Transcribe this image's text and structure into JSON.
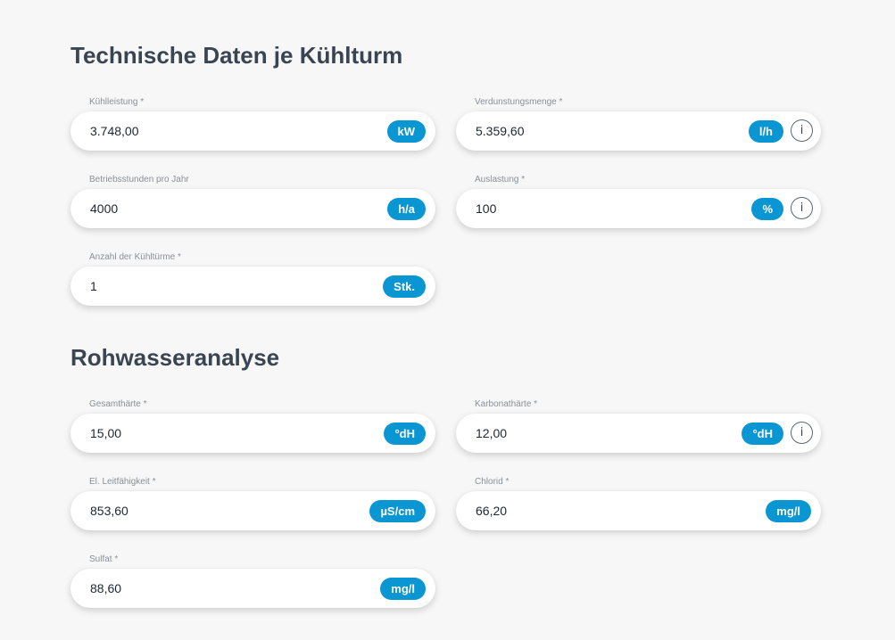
{
  "sections": {
    "technical": {
      "title": "Technische Daten je Kühlturm"
    },
    "water": {
      "title": "Rohwasseranalyse"
    }
  },
  "fields": {
    "kuehlleistung": {
      "label": "Kühlleistung *",
      "value": "3.748,00",
      "unit": "kW"
    },
    "verdunstungsmenge": {
      "label": "Verdunstungsmenge *",
      "value": "5.359,60",
      "unit": "l/h",
      "info": "i"
    },
    "betriebsstunden": {
      "label": "Betriebsstunden pro Jahr",
      "value": "4000",
      "unit": "h/a"
    },
    "auslastung": {
      "label": "Auslastung *",
      "value": "100",
      "unit": "%",
      "info": "i"
    },
    "anzahl": {
      "label": "Anzahl der Kühltürme *",
      "value": "1",
      "unit": "Stk."
    },
    "gesamthaerte": {
      "label": "Gesamthärte *",
      "value": "15,00",
      "unit": "°dH"
    },
    "karbonathaerte": {
      "label": "Karbonathärte *",
      "value": "12,00",
      "unit": "°dH",
      "info": "i"
    },
    "leitfaehigkeit": {
      "label": "El. Leitfähigkeit *",
      "value": "853,60",
      "unit": "µS/cm"
    },
    "chlorid": {
      "label": "Chlorid *",
      "value": "66,20",
      "unit": "mg/l"
    },
    "sulfat": {
      "label": "Sulfat *",
      "value": "88,60",
      "unit": "mg/l"
    }
  },
  "colors": {
    "accent": "#0a96d2",
    "heading": "#3a4553",
    "background": "#f7f7f7"
  }
}
